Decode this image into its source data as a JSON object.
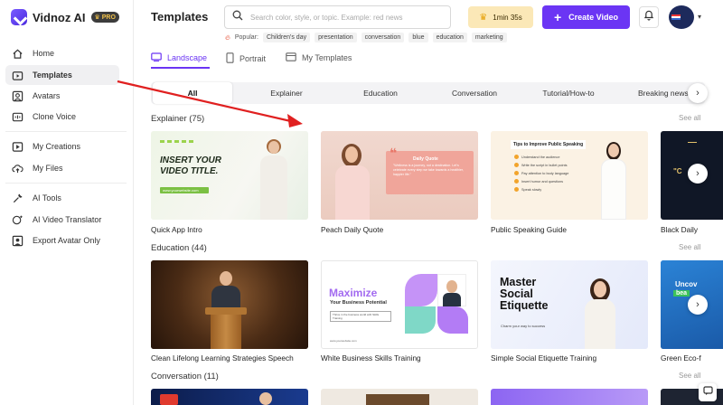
{
  "app": {
    "name": "Vidnoz AI",
    "plan": "PRO"
  },
  "sidebar": {
    "items": [
      {
        "label": "Home",
        "icon": "home-icon"
      },
      {
        "label": "Templates",
        "icon": "templates-icon"
      },
      {
        "label": "Avatars",
        "icon": "avatar-icon"
      },
      {
        "label": "Clone Voice",
        "icon": "voice-icon"
      },
      {
        "label": "My Creations",
        "icon": "play-icon"
      },
      {
        "label": "My Files",
        "icon": "cloud-icon"
      },
      {
        "label": "AI Tools",
        "icon": "tools-icon"
      },
      {
        "label": "AI Video Translator",
        "icon": "translate-icon"
      },
      {
        "label": "Export Avatar Only",
        "icon": "export-icon"
      }
    ]
  },
  "header": {
    "title": "Templates",
    "search_placeholder": "Search color, style, or topic. Example: red news",
    "popular_label": "Popular:",
    "popular_tags": [
      "Children's day",
      "presentation",
      "conversation",
      "blue",
      "education",
      "marketing"
    ],
    "timer": "1min 35s",
    "create_label": "Create Video"
  },
  "orientation_tabs": [
    "Landscape",
    "Portrait",
    "My Templates"
  ],
  "categories": [
    "All",
    "Explainer",
    "Education",
    "Conversation",
    "Tutorial/How-to",
    "Breaking news"
  ],
  "sections": [
    {
      "title": "Explainer (75)",
      "see_all": "See all",
      "cards": [
        {
          "label": "Quick App Intro",
          "thumb_text": "INSERT YOUR VIDEO TITLE.",
          "thumb_sub": "www.yourwebsite.com"
        },
        {
          "label": "Peach Daily Quote",
          "thumb_text": "Daily Quote",
          "thumb_sub": "\"Wellness is a journey, not a destination. Let's celebrate every step we take towards a healthier, happier life.\""
        },
        {
          "label": "Public Speaking Guide",
          "thumb_text": "Tips to Improve Public Speaking",
          "thumb_list": [
            "Understand the audience",
            "Write the script in bullet points",
            "Pay attention to body language",
            "Insert humor and questions",
            "Speak slowly"
          ]
        },
        {
          "label": "Black Daily",
          "thumb_text": "\"C"
        }
      ]
    },
    {
      "title": "Education (44)",
      "see_all": "See all",
      "cards": [
        {
          "label": "Clean Lifelong Learning Strategies Speech"
        },
        {
          "label": "White Business Skills Training",
          "thumb_text": "Maximize",
          "thumb_sub": "Your Business Potential",
          "thumb_note": "Thrive in the business world with Skills Training",
          "thumb_url": "www.yourwebsite.com"
        },
        {
          "label": "Simple Social Etiquette Training",
          "thumb_text": "Master Social Etiquette",
          "thumb_sub": "Charm your way to success"
        },
        {
          "label": "Green Eco-f",
          "thumb_text": "Uncov",
          "thumb_sub": "bea"
        }
      ]
    },
    {
      "title": "Conversation (11)",
      "see_all": "See all"
    }
  ],
  "colors": {
    "accent": "#6b35f4",
    "timer_bg": "#fbe8b7",
    "annotation_arrow": "#e02020"
  }
}
